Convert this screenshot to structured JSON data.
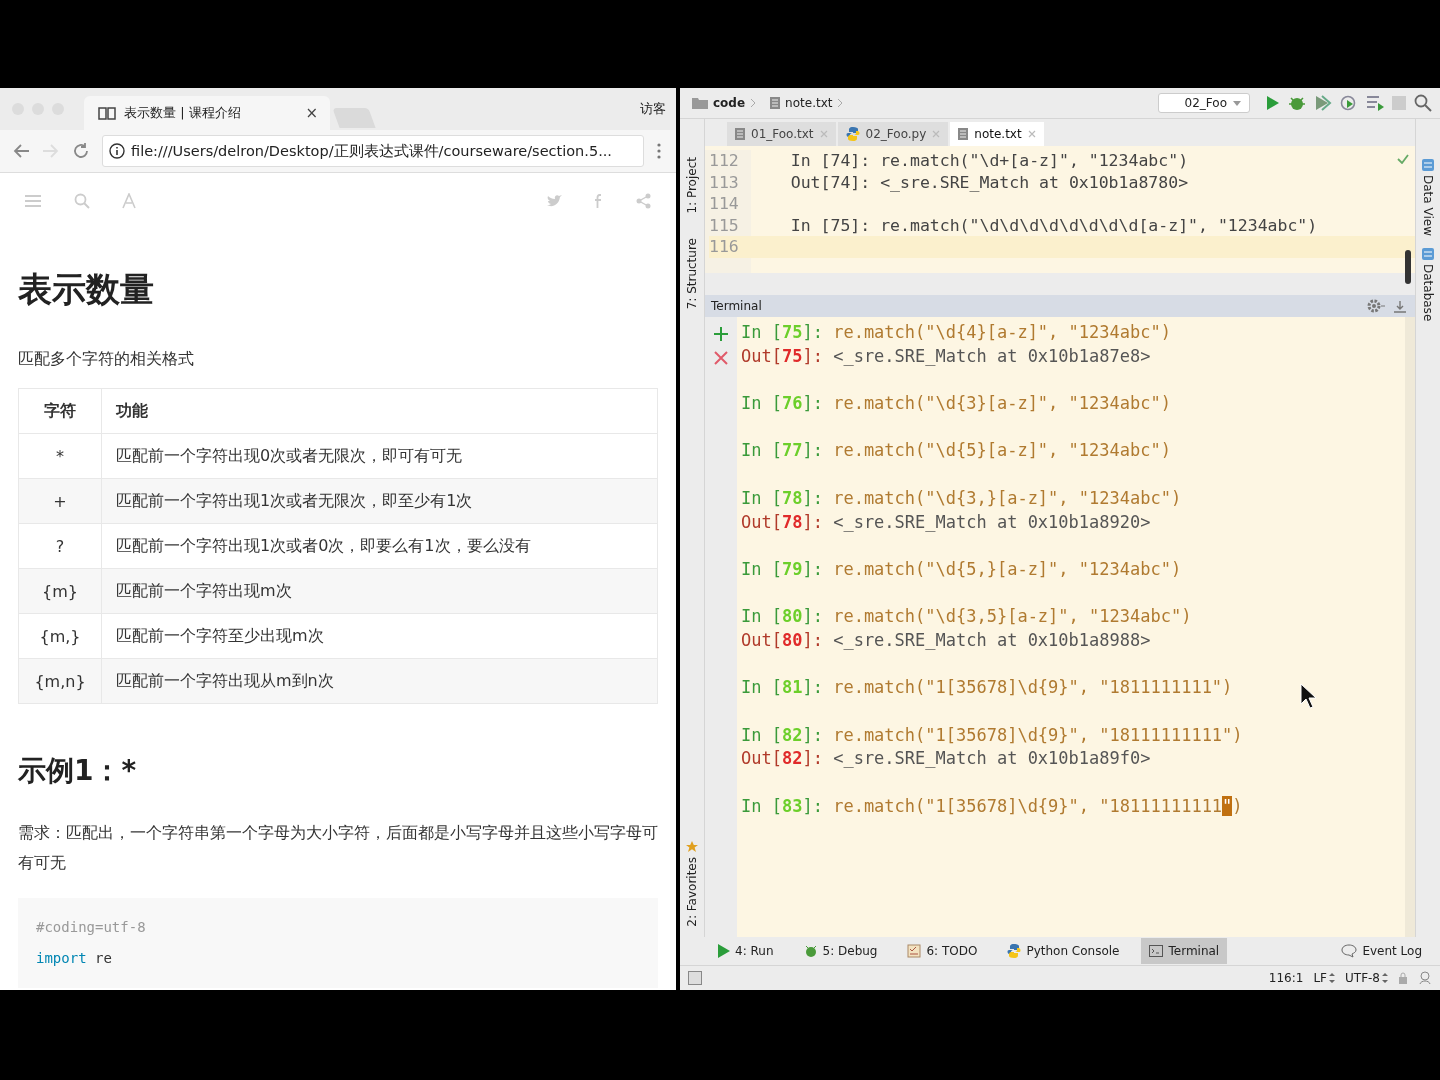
{
  "browser": {
    "tab": {
      "title": "表示数量 | 课程介绍",
      "close": "×"
    },
    "profile": "访客",
    "url": "file:///Users/delron/Desktop/正则表达式课件/courseware/section.5...",
    "article": {
      "title": "表示数量",
      "subtitle": "匹配多个字符的相关格式",
      "table": {
        "columns": [
          "字符",
          "功能"
        ],
        "rows": [
          [
            "*",
            "匹配前一个字符出现0次或者无限次，即可有可无"
          ],
          [
            "+",
            "匹配前一个字符出现1次或者无限次，即至少有1次"
          ],
          [
            "?",
            "匹配前一个字符出现1次或者0次，即要么有1次，要么没有"
          ],
          [
            "{m}",
            "匹配前一个字符出现m次"
          ],
          [
            "{m,}",
            "匹配前一个字符至少出现m次"
          ],
          [
            "{m,n}",
            "匹配前一个字符出现从m到n次"
          ]
        ]
      },
      "example_title": "示例1：*",
      "requirement": "需求：匹配出，一个字符串第一个字母为大小字符，后面都是小写字母并且这些小写字母可有可无",
      "code_lines": [
        {
          "kind": "comment",
          "text": "#coding=utf-8"
        },
        {
          "kind": "import",
          "keyword": "import",
          "text": "re"
        }
      ]
    }
  },
  "ide": {
    "breadcrumb": [
      "code",
      "note.txt"
    ],
    "run_config": "02_Foo",
    "tabs": [
      {
        "label": "01_Foo.txt",
        "kind": "text",
        "selected": false
      },
      {
        "label": "02_Foo.py",
        "kind": "python",
        "selected": false
      },
      {
        "label": "note.txt",
        "kind": "text",
        "selected": true
      }
    ],
    "editor_lines": [
      {
        "number": "112",
        "text": "    In [74]: re.match(\"\\d+[a-z]\", \"1234abc\")",
        "current": false
      },
      {
        "number": "113",
        "text": "    Out[74]: <_sre.SRE_Match at 0x10b1a8780>",
        "current": false
      },
      {
        "number": "114",
        "current": false
      },
      {
        "number": "115",
        "text": "    In [75]: re.match(\"\\d\\d\\d\\d\\d\\d\\d\\d[a-z]\", \"1234abc\")",
        "current": false
      },
      {
        "number": "116",
        "current": true
      }
    ],
    "left_tools": [
      "1: Project",
      "7: Structure",
      "2: Favorites"
    ],
    "right_tools": [
      "Data View",
      "Database"
    ],
    "terminal": {
      "title": "Terminal",
      "lines": [
        {
          "kind": "in",
          "prompt": [
            "In [",
            "75",
            "]:"
          ],
          "code": "re.match(\"\\d{4}[a-z]\", \"1234abc\")"
        },
        {
          "kind": "out",
          "prompt": [
            "Out[",
            "75",
            "]:"
          ],
          "code": "<_sre.SRE_Match at 0x10b1a87e8>"
        },
        {
          "kind": "blank"
        },
        {
          "kind": "in",
          "prompt": [
            "In [",
            "76",
            "]:"
          ],
          "code": "re.match(\"\\d{3}[a-z]\", \"1234abc\")"
        },
        {
          "kind": "blank"
        },
        {
          "kind": "in",
          "prompt": [
            "In [",
            "77",
            "]:"
          ],
          "code": "re.match(\"\\d{5}[a-z]\", \"1234abc\")"
        },
        {
          "kind": "blank"
        },
        {
          "kind": "in",
          "prompt": [
            "In [",
            "78",
            "]:"
          ],
          "code": "re.match(\"\\d{3,}[a-z]\", \"1234abc\")"
        },
        {
          "kind": "out",
          "prompt": [
            "Out[",
            "78",
            "]:"
          ],
          "code": "<_sre.SRE_Match at 0x10b1a8920>"
        },
        {
          "kind": "blank"
        },
        {
          "kind": "in",
          "prompt": [
            "In [",
            "79",
            "]:"
          ],
          "code": "re.match(\"\\d{5,}[a-z]\", \"1234abc\")"
        },
        {
          "kind": "blank"
        },
        {
          "kind": "in",
          "prompt": [
            "In [",
            "80",
            "]:"
          ],
          "code": "re.match(\"\\d{3,5}[a-z]\", \"1234abc\")"
        },
        {
          "kind": "out",
          "prompt": [
            "Out[",
            "80",
            "]:"
          ],
          "code": "<_sre.SRE_Match at 0x10b1a8988>"
        },
        {
          "kind": "blank"
        },
        {
          "kind": "in",
          "prompt": [
            "In [",
            "81",
            "]:"
          ],
          "code": "re.match(\"1[35678]\\d{9}\", \"1811111111\")"
        },
        {
          "kind": "blank"
        },
        {
          "kind": "in",
          "prompt": [
            "In [",
            "82",
            "]:"
          ],
          "code": "re.match(\"1[35678]\\d{9}\", \"18111111111\")"
        },
        {
          "kind": "out",
          "prompt": [
            "Out[",
            "82",
            "]:"
          ],
          "code": "<_sre.SRE_Match at 0x10b1a89f0>"
        },
        {
          "kind": "blank"
        },
        {
          "kind": "in",
          "prompt": [
            "In [",
            "83",
            "]:"
          ],
          "code": "re.match(\"1[35678]\\d{9}\", \"18111111111",
          "cursor": "\"",
          "code_after": ")"
        }
      ]
    },
    "tool_windows": [
      {
        "kind": "run",
        "label": "4: Run",
        "selected": false
      },
      {
        "kind": "debug",
        "label": "5: Debug",
        "selected": false
      },
      {
        "kind": "todo",
        "label": "6: TODO",
        "selected": false
      },
      {
        "kind": "python",
        "label": "Python Console",
        "selected": false
      },
      {
        "kind": "terminal",
        "label": "Terminal",
        "selected": true
      }
    ],
    "event_log": "Event Log",
    "status": {
      "position": "116:1",
      "line_separator": "LF",
      "encoding": "UTF-8"
    }
  }
}
